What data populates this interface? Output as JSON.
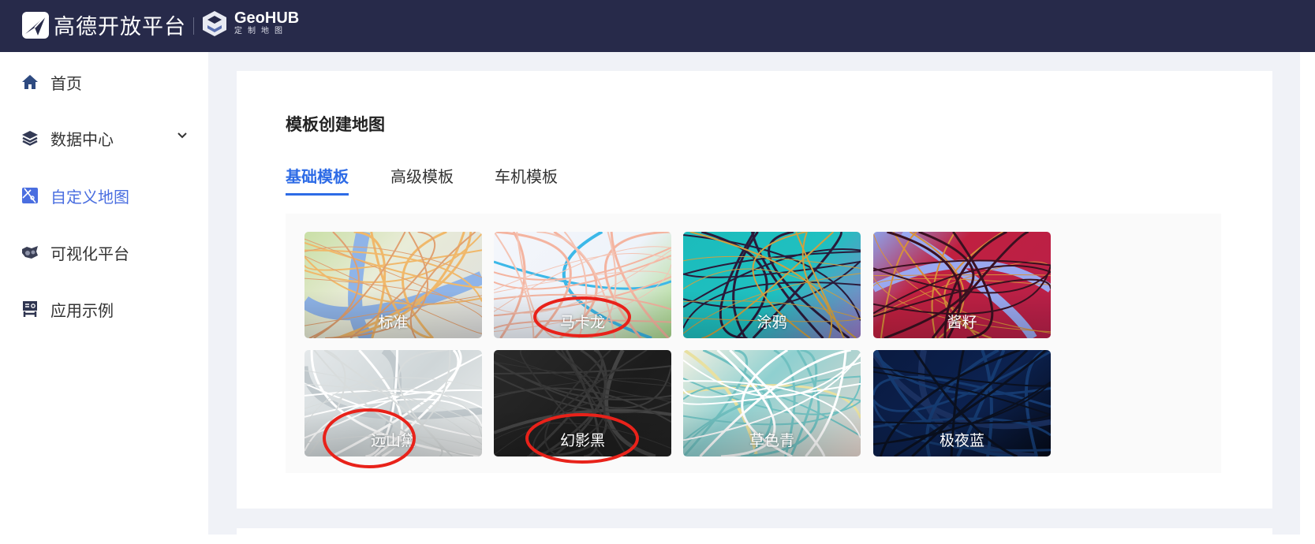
{
  "header": {
    "brand": "高德开放平台",
    "product_title": "GeoHUB",
    "product_subtitle": "定制地图",
    "background": "#272a4a"
  },
  "sidebar": {
    "items": [
      {
        "label": "首页",
        "icon": "home-icon"
      },
      {
        "label": "数据中心",
        "icon": "layers-icon",
        "expandable": true
      },
      {
        "label": "自定义地图",
        "icon": "custom-map-icon",
        "active": true
      },
      {
        "label": "可视化平台",
        "icon": "visualization-icon"
      },
      {
        "label": "应用示例",
        "icon": "app-example-icon"
      }
    ]
  },
  "main": {
    "title": "模板创建地图",
    "tabs": [
      {
        "label": "基础模板",
        "active": true
      },
      {
        "label": "高级模板"
      },
      {
        "label": "车机模板"
      }
    ],
    "templates": [
      {
        "label": "标准",
        "highlighted": false
      },
      {
        "label": "马卡龙",
        "highlighted": true
      },
      {
        "label": "涂鸦",
        "highlighted": false
      },
      {
        "label": "酱籽",
        "highlighted": false
      },
      {
        "label": "远山黛",
        "highlighted": true
      },
      {
        "label": "幻影黑",
        "highlighted": true
      },
      {
        "label": "草色青",
        "highlighted": false
      },
      {
        "label": "极夜蓝",
        "highlighted": false
      }
    ]
  },
  "colors": {
    "accent": "#2d6be6",
    "annotation": "#e8221a"
  }
}
